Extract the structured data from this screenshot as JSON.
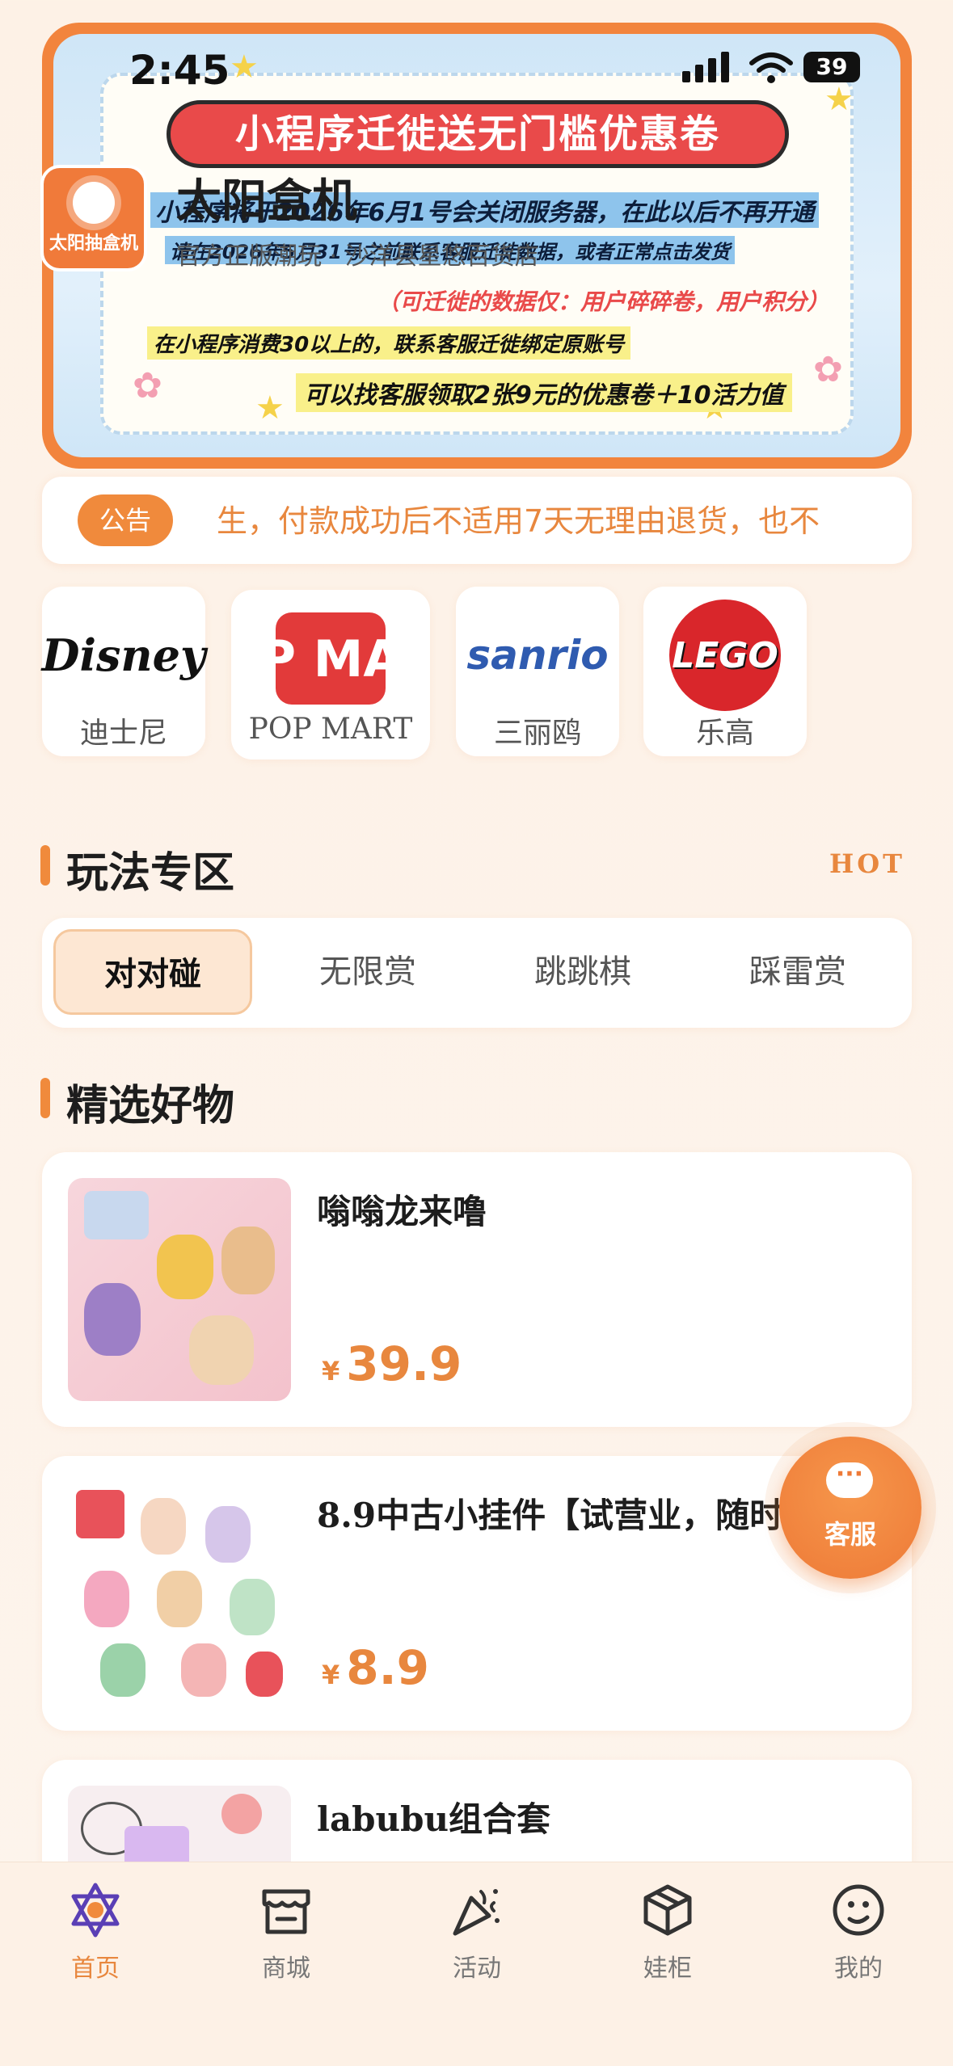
{
  "status_bar": {
    "time": "2:45",
    "battery": "39"
  },
  "banner": {
    "title": "小程序迁徙送无门槛优惠卷",
    "line1": "小程序将于2026年6月1号会关闭服务器，在此以后不再开通",
    "line2": "请在2026年5月31号之前联系客服迁徙数据，或者正常点击发货",
    "line3": "（可迁徙的数据仅：用户碎碎卷，用户积分）",
    "line4": "在小程序消费30以上的，联系客服迁徙绑定原账号",
    "line5": "可以找客服领取2张9元的优惠卷＋10活力值"
  },
  "shop": {
    "logo_text": "太阳抽盒机",
    "name": "太阳盒机",
    "subtitle": "官方正版潮玩 · 沙洋县星悠百货店"
  },
  "notice": {
    "badge": "公告",
    "text": "生，付款成功后不适用7天无理由退货，也不"
  },
  "brands": [
    {
      "label": "迪士尼",
      "logo_text": "Disney"
    },
    {
      "label": "POP MART",
      "logo_text": "P MA"
    },
    {
      "label": "三丽鸥",
      "logo_text": "sanrio"
    },
    {
      "label": "乐高",
      "logo_text": "LEGO"
    }
  ],
  "play_section": {
    "title": "玩法专区",
    "hot": "HOT"
  },
  "play_tabs": [
    "对对碰",
    "无限赏",
    "跳跳棋",
    "踩雷赏"
  ],
  "picks_section": {
    "title": "精选好物"
  },
  "products": [
    {
      "name": "嗡嗡龙来噜",
      "price_symbol": "¥",
      "price": "39.9"
    },
    {
      "name": "8.9中古小挂件【试营业，随时",
      "price_symbol": "¥",
      "price": "8.9"
    },
    {
      "name": "labubu组合套",
      "price_symbol": "¥",
      "price": ""
    }
  ],
  "service_button": {
    "label": "客服",
    "icon": "chat-bubble-icon"
  },
  "tabbar": [
    {
      "label": "首页",
      "icon": "home-icon",
      "active": true
    },
    {
      "label": "商城",
      "icon": "store-icon",
      "active": false
    },
    {
      "label": "活动",
      "icon": "party-icon",
      "active": false
    },
    {
      "label": "娃柜",
      "icon": "box-icon",
      "active": false
    },
    {
      "label": "我的",
      "icon": "profile-icon",
      "active": false
    }
  ],
  "colors": {
    "accent": "#f08a3c",
    "price": "#e8873e",
    "background": "#fdf1e6"
  }
}
